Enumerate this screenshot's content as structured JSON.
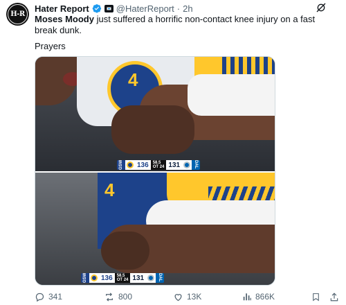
{
  "author": {
    "name": "Hater Report",
    "handle": "@HaterReport",
    "separator": "·",
    "time": "2h",
    "avatar_text": "H-R"
  },
  "tweet": {
    "text_bold": "Moses Moody",
    "text_rest": " just suffered a horrific non-contact knee injury on a fast break dunk.",
    "text_line2": "Prayers"
  },
  "media": {
    "frames": [
      {
        "score": {
          "home_team": "GSW",
          "home_pts": "136",
          "clock_top": "58.5",
          "clock_q": "OT",
          "clock_s": "24",
          "away_pts": "131",
          "away_team": "DAL"
        }
      },
      {
        "score": {
          "home_team": "GSW",
          "home_pts": "136",
          "clock_top": "58.5",
          "clock_q": "OT",
          "clock_s": "24",
          "away_pts": "131",
          "away_team": "DAL"
        }
      }
    ]
  },
  "actions": {
    "replies": "341",
    "reposts": "800",
    "likes": "13K",
    "views": "866K"
  },
  "icons": [
    "verified-icon",
    "flag-icon",
    "grok-icon",
    "reply-icon",
    "repost-icon",
    "like-icon",
    "views-icon",
    "bookmark-icon",
    "share-icon"
  ],
  "colors": {
    "verified": "#1d9bf0",
    "muted": "#536471",
    "warriors_blue": "#1d428a",
    "warriors_gold": "#ffc72c"
  }
}
